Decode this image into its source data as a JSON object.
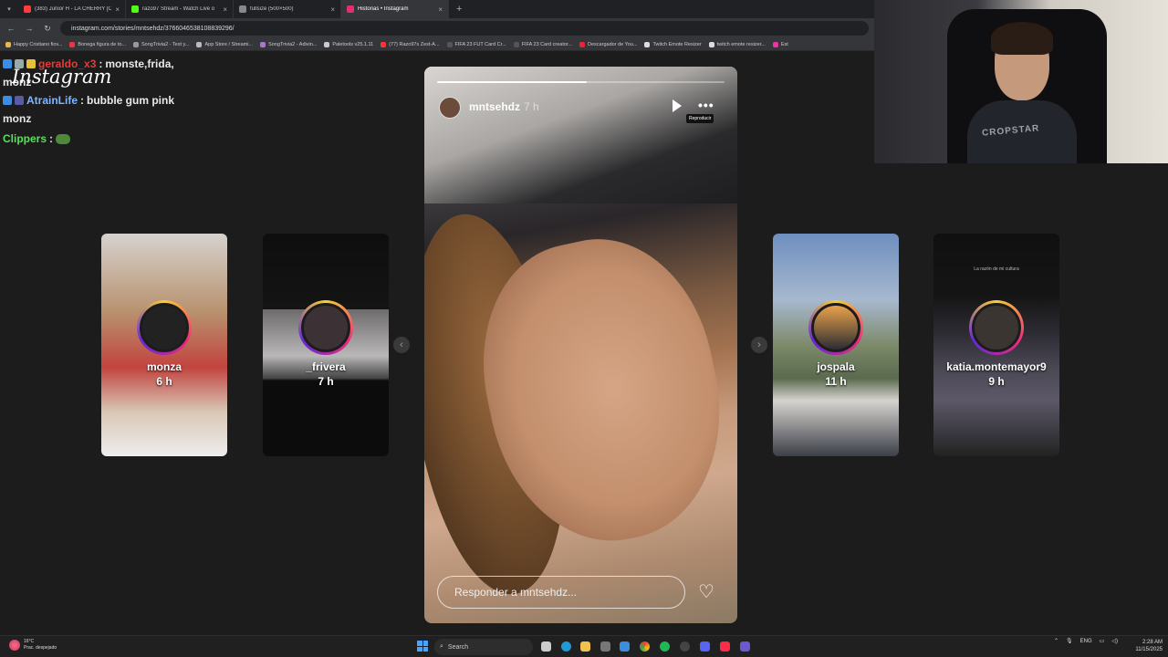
{
  "browser": {
    "tabs": [
      {
        "title": "(383) Junior H - LA CHERRY [O",
        "color": "#ff3b3b"
      },
      {
        "title": "razo97 Stream - Watch Live o",
        "color": "#53fc18"
      },
      {
        "title": "fullsize (500×500)",
        "color": "#888888"
      },
      {
        "title": "Historias • Instagram",
        "color": "#e1306c"
      }
    ],
    "url": "instagram.com/stories/mntsehdz/3766046538108839296/",
    "bookmarks": [
      "Happy Cristiano fiov...",
      "Bonega figura de to...",
      "SongTrivia2 - Test y...",
      "App Store / Streami...",
      "SongTrivia2 - Adivin...",
      "Paletools v25.1.11",
      "(77) Razo97s Zest-A...",
      "FIFA 23 FUT Card Cr...",
      "FIFA 23 Card creator...",
      "Descargador de You...",
      "Twitch Emote Resizer",
      "twitch emote resizer...",
      "Est"
    ]
  },
  "chat": {
    "lines": [
      {
        "user": "geraldo_x3",
        "user_color": "#e33b3b",
        "message": "monste,frida,"
      },
      {
        "user": "",
        "user_color": "#ffffff",
        "message": "monz"
      },
      {
        "user": "AtrainLife",
        "user_color": "#7fb5ff",
        "message": "bubble gum pink"
      },
      {
        "user": "",
        "user_color": "#ffffff",
        "message": "monz"
      },
      {
        "user": "Clippers",
        "user_color": "#58e05a",
        "message": ""
      }
    ],
    "overlay_logo": "Instagram"
  },
  "stories": {
    "left": [
      {
        "user": "monza",
        "time": "6 h"
      },
      {
        "user": "_frivera",
        "time": "7 h"
      }
    ],
    "right": [
      {
        "user": "jospala",
        "time": "11 h"
      },
      {
        "user": "katia.montemayor9",
        "time": "9 h"
      }
    ],
    "main": {
      "user": "mntsehdz",
      "time": "7 h",
      "progress": 0.52,
      "tooltip": "Reproducir",
      "reply_placeholder": "Responder a mntsehdz..."
    },
    "card_caption": "La razón de mi cultura"
  },
  "webcam": {
    "shirt_text": "CROPSTAR"
  },
  "taskbar": {
    "temperature": "16°C",
    "weather": "Prac. despejado",
    "search_label": "Search",
    "language": "ENG",
    "time": "2:28 AM",
    "date": "11/15/2025"
  }
}
